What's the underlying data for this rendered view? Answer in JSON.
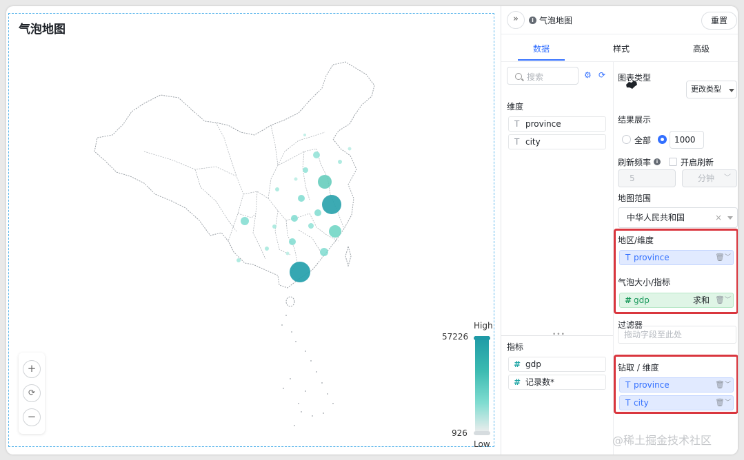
{
  "canvas": {
    "title": "气泡地图",
    "legend": {
      "high_label": "High",
      "low_label": "Low",
      "max_value": "57226",
      "min_value": "926"
    }
  },
  "colors": {
    "accent": "#3370ff",
    "bubble_high": "#1f9aa6",
    "bubble_low": "#7fdcd0",
    "highlight_box": "#d9363e",
    "map_border": "#9aa0a6"
  },
  "panel": {
    "title": "气泡地图",
    "reset_label": "重置",
    "tabs": [
      {
        "label": "数据",
        "active": true
      },
      {
        "label": "样式",
        "active": false
      },
      {
        "label": "高级",
        "active": false
      }
    ],
    "search_placeholder": "搜索",
    "dimension_label": "维度",
    "dimensions": [
      {
        "type": "T",
        "name": "province"
      },
      {
        "type": "T",
        "name": "city"
      }
    ],
    "metric_label": "指标",
    "metrics": [
      {
        "type": "#",
        "name": "gdp"
      },
      {
        "type": "#",
        "name": "记录数*"
      }
    ],
    "chart_type_label": "图表类型",
    "change_type_label": "更改类型",
    "result_label": "结果展示",
    "result_all_label": "全部",
    "result_limit_value": "1000",
    "refresh_label": "刷新频率",
    "auto_refresh_label": "开启刷新",
    "refresh_interval": "5",
    "refresh_unit": "分钟",
    "map_range_label": "地图范围",
    "map_range_value": "中华人民共和国",
    "area_dim_label": "地区/维度",
    "area_dim_field": {
      "type": "T",
      "name": "province"
    },
    "bubble_size_label": "气泡大小/指标",
    "bubble_size_field": {
      "type": "#",
      "name": "gdp",
      "aggregation": "求和"
    },
    "filter_label": "过滤器",
    "filter_placeholder": "拖动字段至此处",
    "drill_label": "钻取 / 维度",
    "drill_fields": [
      {
        "type": "T",
        "name": "province"
      },
      {
        "type": "T",
        "name": "city"
      }
    ]
  },
  "watermark": "@稀土掘金技术社区"
}
